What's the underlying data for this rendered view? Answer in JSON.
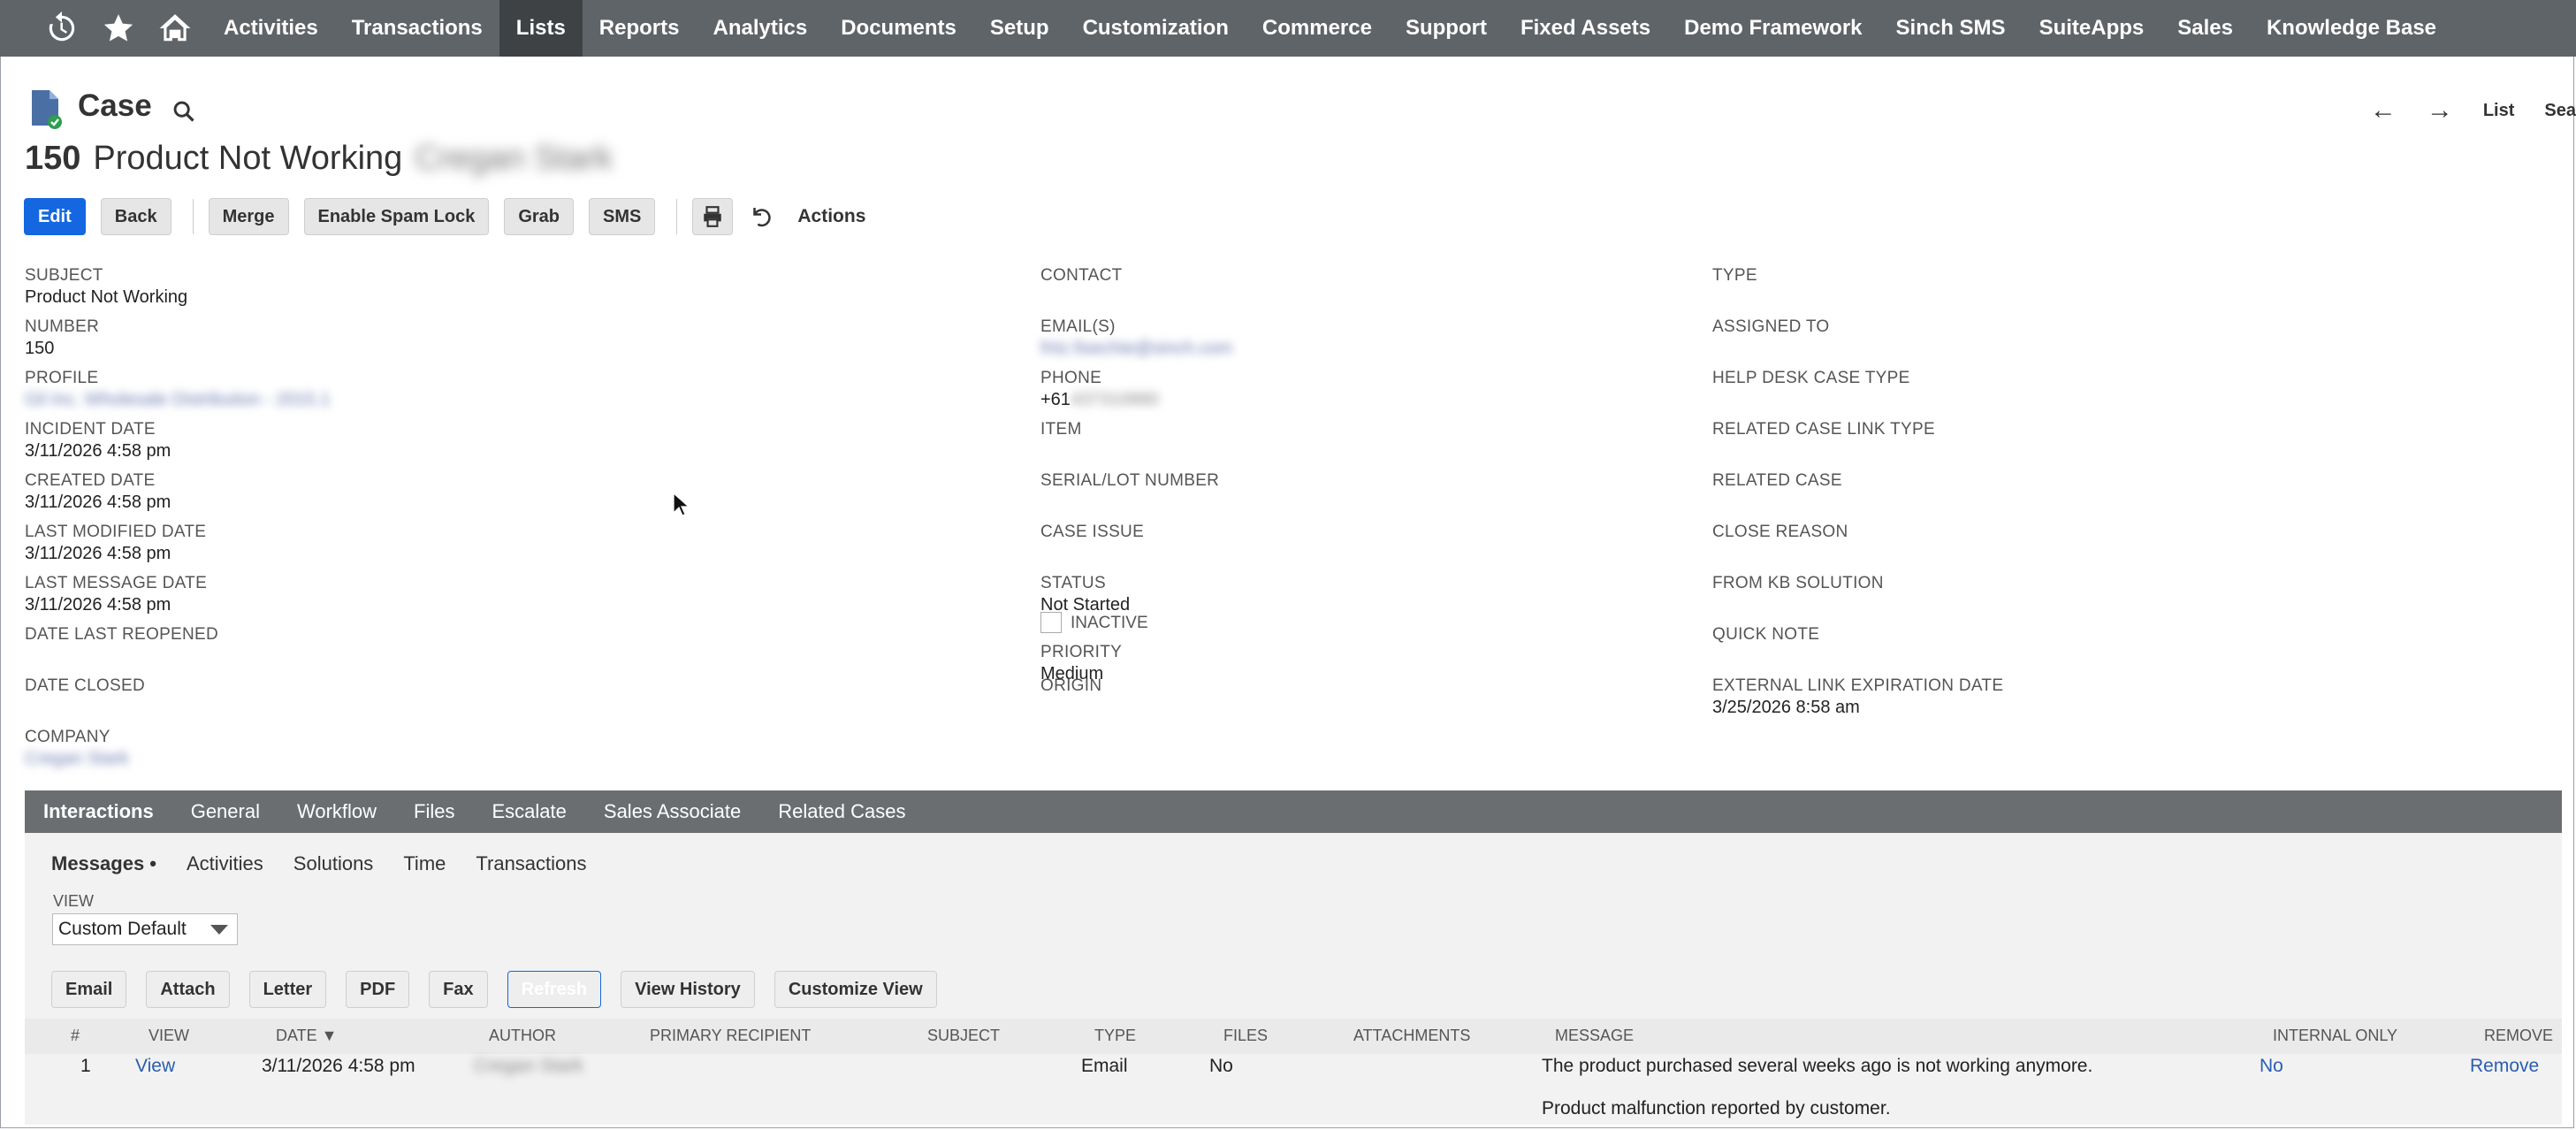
{
  "nav": {
    "items": [
      "Activities",
      "Transactions",
      "Lists",
      "Reports",
      "Analytics",
      "Documents",
      "Setup",
      "Customization",
      "Commerce",
      "Support",
      "Fixed Assets",
      "Demo Framework",
      "Sinch SMS",
      "SuiteApps",
      "Sales",
      "Knowledge Base"
    ],
    "active": "Lists"
  },
  "header": {
    "record_type": "Case",
    "number": "150",
    "subject": "Product Not Working",
    "customer": "Cregan Stark",
    "right_nav": {
      "list": "List",
      "search": "Sea"
    }
  },
  "buttons": {
    "edit": "Edit",
    "back": "Back",
    "merge": "Merge",
    "spam": "Enable Spam Lock",
    "grab": "Grab",
    "sms": "SMS",
    "actions": "Actions"
  },
  "fields": {
    "col1": [
      {
        "label": "Subject",
        "value": "Product Not Working"
      },
      {
        "label": "Number",
        "value": "150"
      },
      {
        "label": "Profile",
        "value": "Gil Inc. Wholesale Distribution - 2015.1",
        "blurred": true
      },
      {
        "label": "Incident Date",
        "value": "3/11/2026 4:58 pm"
      },
      {
        "label": "Created Date",
        "value": "3/11/2026 4:58 pm"
      },
      {
        "label": "Last Modified Date",
        "value": "3/11/2026 4:58 pm"
      },
      {
        "label": "Last Message Date",
        "value": "3/11/2026 4:58 pm"
      },
      {
        "label": "Date Last Reopened",
        "value": ""
      },
      {
        "label": "Date Closed",
        "value": ""
      },
      {
        "label": "Company",
        "value": "Cregan Stark",
        "blurred": true
      }
    ],
    "col2": [
      {
        "label": "Contact",
        "value": ""
      },
      {
        "label": "Email(s)",
        "value": "fritz.fisechte@sinch.com",
        "blurred": true
      },
      {
        "label": "Phone",
        "value": "+61",
        "blur_tail": "437310880"
      },
      {
        "label": "Item",
        "value": ""
      },
      {
        "label": "Serial/Lot Number",
        "value": ""
      },
      {
        "label": "Case Issue",
        "value": ""
      },
      {
        "label": "Status",
        "value": "Not Started"
      },
      {
        "label": "Inactive",
        "checkbox": true
      },
      {
        "label": "Priority",
        "value": "Medium"
      },
      {
        "label": "Origin",
        "value": ""
      }
    ],
    "col3": [
      {
        "label": "Type",
        "value": ""
      },
      {
        "label": "Assigned To",
        "value": ""
      },
      {
        "label": "Help Desk Case Type",
        "value": ""
      },
      {
        "label": "Related Case Link Type",
        "value": ""
      },
      {
        "label": "Related Case",
        "value": ""
      },
      {
        "label": "Close Reason",
        "value": ""
      },
      {
        "label": "From KB Solution",
        "value": ""
      },
      {
        "label": "Quick Note",
        "value": ""
      },
      {
        "label": "External Link Expiration Date",
        "value": "3/25/2026 8:58 am"
      }
    ]
  },
  "subtabs": [
    "Interactions",
    "General",
    "Workflow",
    "Files",
    "Escalate",
    "Sales Associate",
    "Related Cases"
  ],
  "inner_tabs": [
    "Messages •",
    "Activities",
    "Solutions",
    "Time",
    "Transactions"
  ],
  "view": {
    "label": "VIEW",
    "selected": "Custom Default"
  },
  "message_buttons": [
    "Email",
    "Attach",
    "Letter",
    "PDF",
    "Fax",
    "Refresh",
    "View History",
    "Customize View"
  ],
  "table": {
    "headers": [
      "#",
      "View",
      "Date ▼",
      "Author",
      "Primary Recipient",
      "Subject",
      "Type",
      "Files",
      "Attachments",
      "Message",
      "Internal Only",
      "Remove"
    ],
    "rows": [
      {
        "num": "1",
        "view": "View",
        "date": "3/11/2026 4:58 pm",
        "author": "Cregan Stark",
        "type": "Email",
        "files": "No",
        "message": "The product purchased several weeks ago is not working anymore.",
        "message2": "Product malfunction reported by customer.",
        "internal": "No",
        "remove": "Remove"
      }
    ]
  },
  "colors": {
    "nav_bg": "#5f6468",
    "primary": "#1467e0",
    "subtab_bg": "#6a6e71",
    "link": "#2a5db0"
  }
}
